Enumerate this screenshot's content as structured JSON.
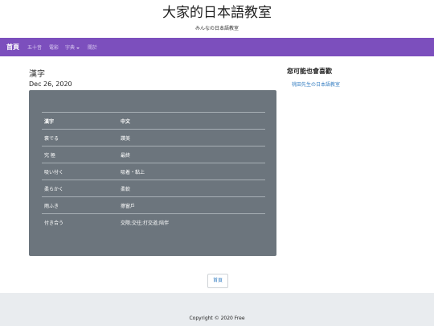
{
  "site": {
    "title": "大家的日本語教室",
    "subtitle": "みんなの日本語教室"
  },
  "nav": {
    "brand": "首頁",
    "items": [
      {
        "label": "五十音"
      },
      {
        "label": "電影"
      },
      {
        "label": "字典"
      },
      {
        "label": "關於"
      }
    ],
    "color": "#7c4fbd"
  },
  "post": {
    "title": "漢字",
    "date": "Dec 26, 2020",
    "table": {
      "headers": [
        "漢字",
        "中文"
      ],
      "rows": [
        {
          "jp": "褒でる",
          "zh": "讚美"
        },
        {
          "jp": "究 極",
          "zh": "最終"
        },
        {
          "jp": "吸い付く",
          "zh": "吸着・黏上"
        },
        {
          "jp": "柔らかく",
          "zh": "柔軟"
        },
        {
          "jp": "雨ふき",
          "zh": "擦窗戶"
        },
        {
          "jp": "付き合う",
          "zh": "交際;交往;打交道;陪伴"
        }
      ]
    }
  },
  "sidebar": {
    "title": "您可能也會喜歡",
    "link": "桃田先生の日本語教室"
  },
  "home_button": "首頁",
  "footer": {
    "copyright": "Copyright © 2020 Free"
  }
}
